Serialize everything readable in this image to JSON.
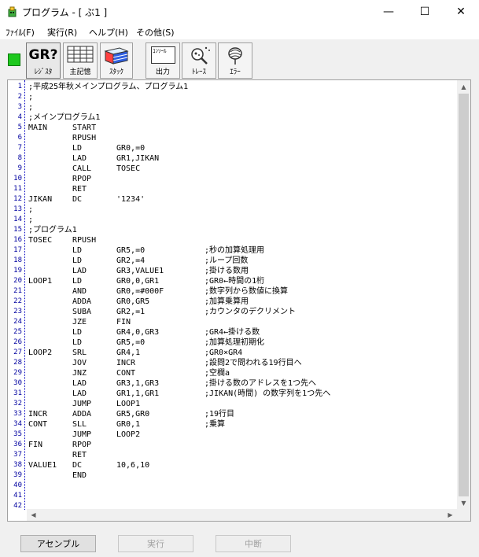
{
  "window": {
    "title": "プログラム - [ ぶ1 ]",
    "minimize_glyph": "—",
    "maximize_glyph": "☐",
    "close_glyph": "✕"
  },
  "menu": [
    "ﾌｧｲﾙ(F)",
    "実行(R)",
    "ヘルプ(H)",
    "その他(S)"
  ],
  "toolbar": {
    "status_color": "#1ec81e",
    "register": {
      "label": "ﾚｼﾞｽﾀ",
      "icon_text": "GR?"
    },
    "memory": {
      "label": "主記憶"
    },
    "stack": {
      "label": "ｽﾀｯｸ"
    },
    "output": {
      "label": "出力",
      "icon_text": "ｺﾝｿｰﾙ"
    },
    "trace": {
      "label": "ﾄﾚｰｽ"
    },
    "error": {
      "label": "ｴﾗｰ"
    }
  },
  "editor": {
    "lines": [
      {
        "n": "1",
        "c1": ";平成25年秋メインプログラム、プログラム1",
        "c2": "",
        "c3": "",
        "c4": ""
      },
      {
        "n": "2",
        "c1": ";",
        "c2": "",
        "c3": "",
        "c4": ""
      },
      {
        "n": "3",
        "c1": ";",
        "c2": "",
        "c3": "",
        "c4": ""
      },
      {
        "n": "4",
        "c1": ";メインプログラム1",
        "c2": "",
        "c3": "",
        "c4": ""
      },
      {
        "n": "5",
        "c1": "MAIN",
        "c2": "START",
        "c3": "",
        "c4": ""
      },
      {
        "n": "6",
        "c1": "",
        "c2": "RPUSH",
        "c3": "",
        "c4": ""
      },
      {
        "n": "7",
        "c1": "",
        "c2": "LD",
        "c3": "GR0,=0",
        "c4": ""
      },
      {
        "n": "8",
        "c1": "",
        "c2": "LAD",
        "c3": "GR1,JIKAN",
        "c4": ""
      },
      {
        "n": "9",
        "c1": "",
        "c2": "CALL",
        "c3": "TOSEC",
        "c4": ""
      },
      {
        "n": "10",
        "c1": "",
        "c2": "RPOP",
        "c3": "",
        "c4": ""
      },
      {
        "n": "11",
        "c1": "",
        "c2": "RET",
        "c3": "",
        "c4": ""
      },
      {
        "n": "12",
        "c1": "JIKAN",
        "c2": "DC",
        "c3": "'1234'",
        "c4": ""
      },
      {
        "n": "13",
        "c1": ";",
        "c2": "",
        "c3": "",
        "c4": ""
      },
      {
        "n": "14",
        "c1": ";",
        "c2": "",
        "c3": "",
        "c4": ""
      },
      {
        "n": "15",
        "c1": ";プログラム1",
        "c2": "",
        "c3": "",
        "c4": ""
      },
      {
        "n": "16",
        "c1": "TOSEC",
        "c2": "RPUSH",
        "c3": "",
        "c4": ""
      },
      {
        "n": "17",
        "c1": "",
        "c2": "LD",
        "c3": "GR5,=0",
        "c4": ";秒の加算処理用"
      },
      {
        "n": "18",
        "c1": "",
        "c2": "LD",
        "c3": "GR2,=4",
        "c4": ";ループ回数"
      },
      {
        "n": "19",
        "c1": "",
        "c2": "LAD",
        "c3": "GR3,VALUE1",
        "c4": ";掛ける数用"
      },
      {
        "n": "20",
        "c1": "LOOP1",
        "c2": "LD",
        "c3": "GR0,0,GR1",
        "c4": ";GR0←時間の1桁"
      },
      {
        "n": "21",
        "c1": "",
        "c2": "AND",
        "c3": "GR0,=#000F",
        "c4": ";数字列から数値に換算"
      },
      {
        "n": "22",
        "c1": "",
        "c2": "ADDA",
        "c3": "GR0,GR5",
        "c4": ";加算乗算用"
      },
      {
        "n": "23",
        "c1": "",
        "c2": "SUBA",
        "c3": "GR2,=1",
        "c4": ";カウンタのデクリメント"
      },
      {
        "n": "24",
        "c1": "",
        "c2": "JZE",
        "c3": "FIN",
        "c4": ""
      },
      {
        "n": "25",
        "c1": "",
        "c2": "LD",
        "c3": "GR4,0,GR3",
        "c4": ";GR4←掛ける数"
      },
      {
        "n": "26",
        "c1": "",
        "c2": "LD",
        "c3": "GR5,=0",
        "c4": ";加算処理初期化"
      },
      {
        "n": "27",
        "c1": "LOOP2",
        "c2": "SRL",
        "c3": "GR4,1",
        "c4": ";GR0×GR4"
      },
      {
        "n": "28",
        "c1": "",
        "c2": "JOV",
        "c3": "INCR",
        "c4": ";設問2で問われる19行目へ"
      },
      {
        "n": "29",
        "c1": "",
        "c2": "JNZ",
        "c3": "CONT",
        "c4": ";空欄a"
      },
      {
        "n": "30",
        "c1": "",
        "c2": "LAD",
        "c3": "GR3,1,GR3",
        "c4": ";掛ける数のアドレスを1つ先へ"
      },
      {
        "n": "31",
        "c1": "",
        "c2": "LAD",
        "c3": "GR1,1,GR1",
        "c4": ";JIKAN(時間) の数字列を1つ先へ"
      },
      {
        "n": "32",
        "c1": "",
        "c2": "JUMP",
        "c3": "LOOP1",
        "c4": ""
      },
      {
        "n": "33",
        "c1": "INCR",
        "c2": "ADDA",
        "c3": "GR5,GR0",
        "c4": ";19行目"
      },
      {
        "n": "34",
        "c1": "CONT",
        "c2": "SLL",
        "c3": "GR0,1",
        "c4": ";乗算"
      },
      {
        "n": "35",
        "c1": "",
        "c2": "JUMP",
        "c3": "LOOP2",
        "c4": ""
      },
      {
        "n": "36",
        "c1": "FIN",
        "c2": "RPOP",
        "c3": "",
        "c4": ""
      },
      {
        "n": "37",
        "c1": "",
        "c2": "RET",
        "c3": "",
        "c4": ""
      },
      {
        "n": "38",
        "c1": "VALUE1",
        "c2": "DC",
        "c3": "10,6,10",
        "c4": ""
      },
      {
        "n": "39",
        "c1": "",
        "c2": "END",
        "c3": "",
        "c4": ""
      },
      {
        "n": "40",
        "c1": "",
        "c2": "",
        "c3": "",
        "c4": ""
      },
      {
        "n": "41",
        "c1": "",
        "c2": "",
        "c3": "",
        "c4": ""
      },
      {
        "n": "42",
        "c1": "",
        "c2": "",
        "c3": "",
        "c4": ""
      }
    ]
  },
  "buttons": {
    "assemble": "アセンブル",
    "run": "実行",
    "stop": "中断"
  }
}
